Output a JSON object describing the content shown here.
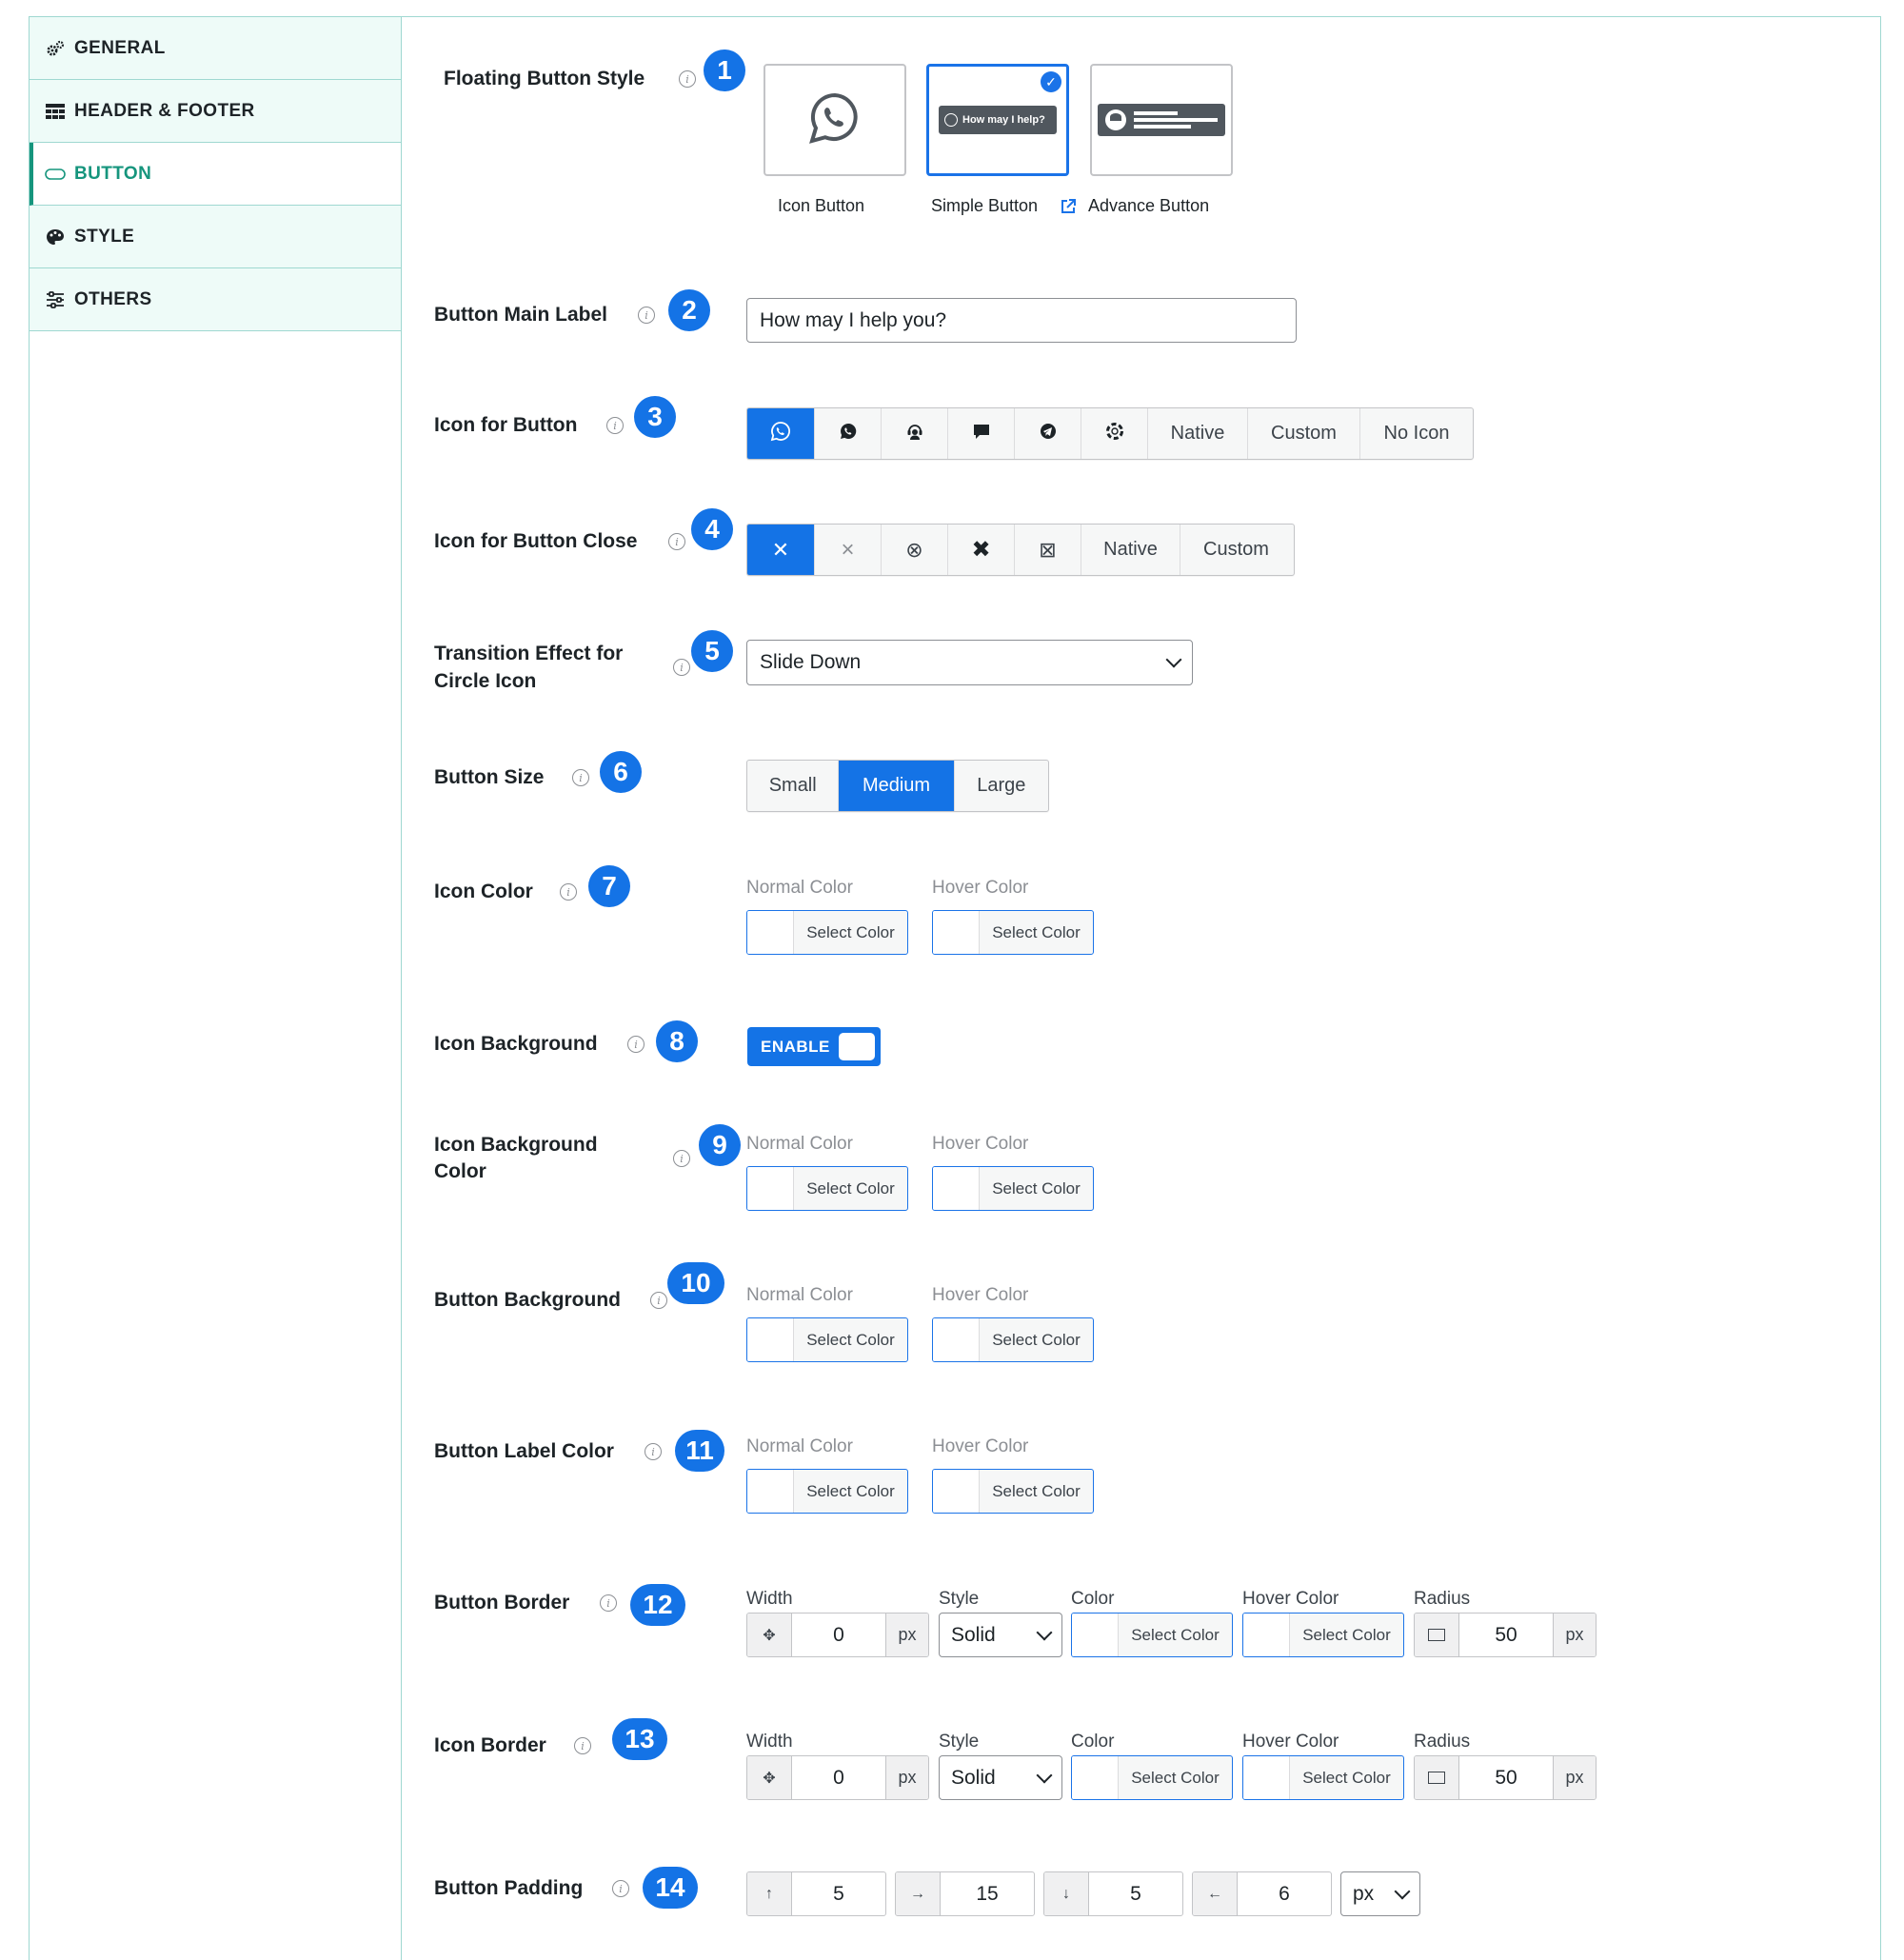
{
  "sidebar": {
    "items": [
      {
        "label": "GENERAL",
        "icon": "gears-icon"
      },
      {
        "label": "HEADER & FOOTER",
        "icon": "table-icon"
      },
      {
        "label": "BUTTON",
        "icon": "button-shape-icon"
      },
      {
        "label": "STYLE",
        "icon": "palette-icon"
      },
      {
        "label": "OTHERS",
        "icon": "sliders-icon"
      }
    ],
    "active": "BUTTON"
  },
  "badges": [
    "1",
    "2",
    "3",
    "4",
    "5",
    "6",
    "7",
    "8",
    "9",
    "10",
    "11",
    "12",
    "13",
    "14"
  ],
  "floating_style": {
    "label": "Floating Button Style",
    "cards": [
      {
        "caption": "Icon Button",
        "selected": false
      },
      {
        "caption": "Simple Button",
        "selected": true,
        "preview_text": "How may I help?"
      },
      {
        "caption": "Advance Button",
        "selected": false
      }
    ]
  },
  "main_label": {
    "label": "Button Main Label",
    "value": "How may I help you?"
  },
  "icon_for_button": {
    "label": "Icon for Button",
    "options": [
      "whatsapp-icon",
      "chat-bubble-icon",
      "support-agent-icon",
      "comment-icon",
      "telegram-icon",
      "lifebuoy-icon"
    ],
    "text_options": [
      "Native",
      "Custom",
      "No Icon"
    ],
    "selected_index": 0
  },
  "icon_close": {
    "label": "Icon for Button Close",
    "glyphs": [
      "✕",
      "×",
      "⊗",
      "✖",
      "⊠"
    ],
    "text_options": [
      "Native",
      "Custom"
    ],
    "selected_index": 0
  },
  "transition": {
    "label_line1": "Transition Effect for",
    "label_line2": "Circle Icon",
    "value": "Slide Down"
  },
  "button_size": {
    "label": "Button Size",
    "options": [
      "Small",
      "Medium",
      "Large"
    ],
    "selected": "Medium"
  },
  "color_labels": {
    "normal": "Normal Color",
    "hover": "Hover Color",
    "select": "Select Color"
  },
  "icon_color": {
    "label": "Icon Color"
  },
  "icon_background": {
    "label": "Icon Background",
    "toggle": "ENABLE"
  },
  "icon_bg_color": {
    "label_line1": "Icon Background",
    "label_line2": "Color"
  },
  "button_background": {
    "label": "Button Background"
  },
  "button_label_color": {
    "label": "Button Label Color"
  },
  "border_labels": {
    "width": "Width",
    "style": "Style",
    "color": "Color",
    "hover": "Hover Color",
    "radius": "Radius",
    "unit": "px"
  },
  "button_border": {
    "label": "Button Border",
    "width": "0",
    "style": "Solid",
    "radius": "50"
  },
  "icon_border": {
    "label": "Icon Border",
    "width": "0",
    "style": "Solid",
    "radius": "50"
  },
  "padding": {
    "label": "Button Padding",
    "top": "5",
    "right": "15",
    "bottom": "5",
    "left": "6",
    "unit": "px",
    "arrows": {
      "top": "↑",
      "right": "→",
      "bottom": "↓",
      "left": "←"
    }
  },
  "colors": {
    "accent": "#1473e6",
    "teal": "#16957d",
    "sidebar_bg": "#eefbf8"
  }
}
